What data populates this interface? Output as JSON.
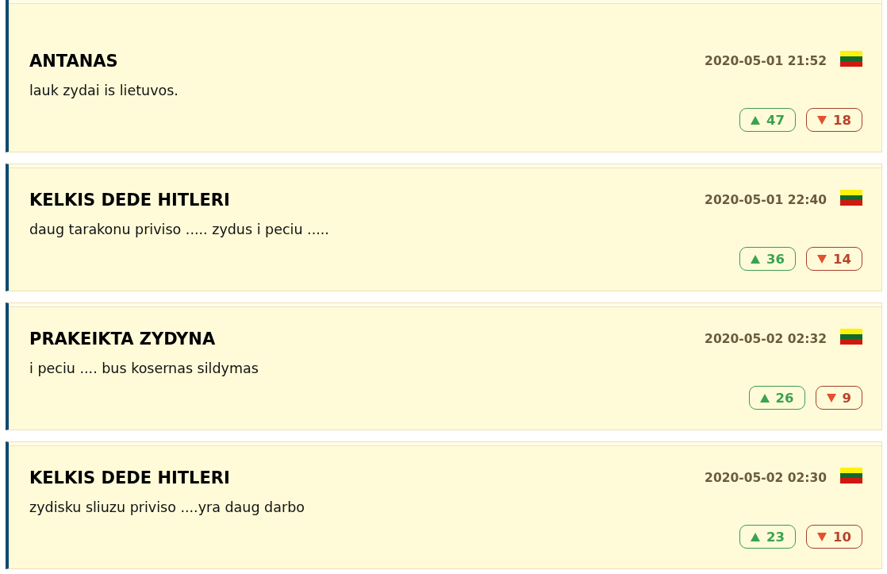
{
  "comments": [
    {
      "author": "ANTANAS",
      "date": "2020-05-01 21:52",
      "text": "lauk zydai is lietuvos.",
      "upvotes": "47",
      "downvotes": "18"
    },
    {
      "author": "KELKIS DEDE HITLERI",
      "date": "2020-05-01 22:40",
      "text": "daug tarakonu priviso ..... zydus i peciu .....",
      "upvotes": "36",
      "downvotes": "14"
    },
    {
      "author": "PRAKEIKTA ZYDYNA",
      "date": "2020-05-02 02:32",
      "text": "i peciu .... bus kosernas sildymas",
      "upvotes": "26",
      "downvotes": "9"
    },
    {
      "author": "KELKIS DEDE HITLERI",
      "date": "2020-05-02 02:30",
      "text": "zydisku sliuzu priviso ....yra daug darbo",
      "upvotes": "23",
      "downvotes": "10"
    }
  ]
}
